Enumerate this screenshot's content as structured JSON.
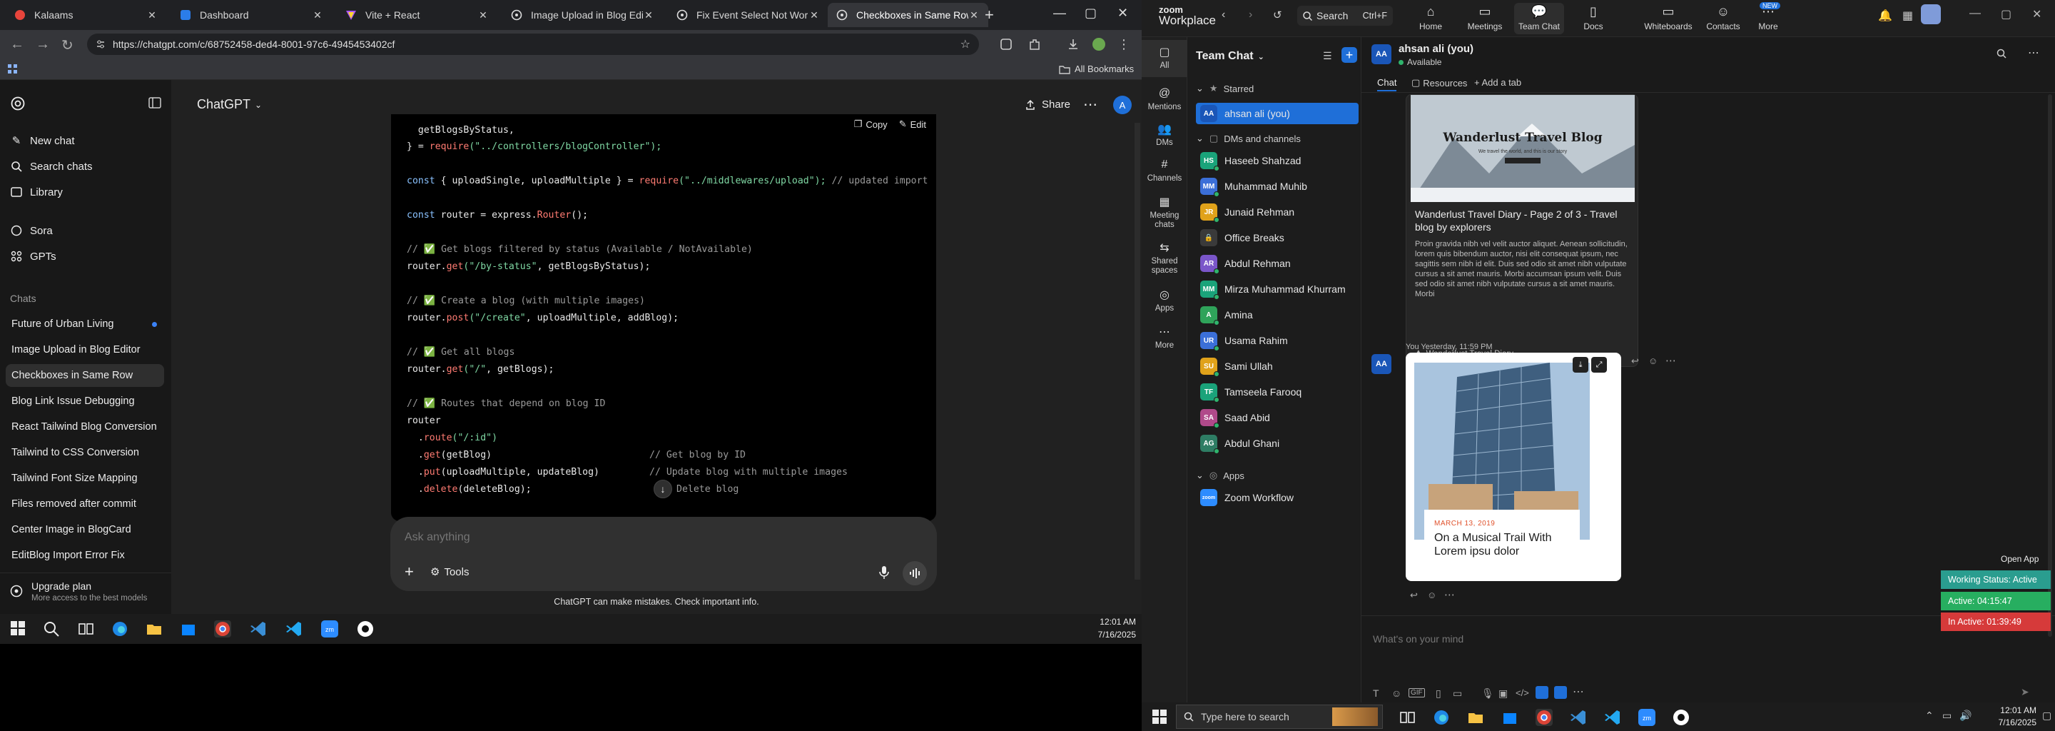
{
  "browser": {
    "tabs": [
      {
        "label": "Kalaams",
        "color": "#e8453c"
      },
      {
        "label": "Dashboard",
        "color": "#2b7de9"
      },
      {
        "label": "Vite + React",
        "color": "#a855f7"
      },
      {
        "label": "Image Upload in Blog Editor",
        "color": "#9aa0a6"
      },
      {
        "label": "Fix Event Select Not Working",
        "color": "#9aa0a6"
      },
      {
        "label": "Checkboxes in Same Row",
        "color": "#9aa0a6"
      }
    ],
    "url": "https://chatgpt.com/c/68752458-ded4-8001-97c6-4945453402cf",
    "all_bookmarks": "All Bookmarks"
  },
  "gpt": {
    "model": "ChatGPT",
    "share": "Share",
    "avatar": "A",
    "sidebar": {
      "new_chat": "New chat",
      "search": "Search chats",
      "library": "Library",
      "sora": "Sora",
      "gpts": "GPTs",
      "chats_heading": "Chats",
      "chats": [
        "Future of Urban Living",
        "Image Upload in Blog Editor",
        "Checkboxes in Same Row",
        "Blog Link Issue Debugging",
        "React Tailwind Blog Conversion",
        "Tailwind to CSS Conversion",
        "Tailwind Font Size Mapping",
        "Files removed after commit",
        "Center Image in BlogCard",
        "EditBlog Import Error Fix"
      ],
      "upgrade_title": "Upgrade plan",
      "upgrade_sub": "More access to the best models"
    },
    "code": {
      "copy": "Copy",
      "edit": "Edit",
      "l1": "  getBlogsByStatus,",
      "l2a": "} = ",
      "l2b": "require",
      "l2c": "(\"../controllers/blogController\");",
      "l3a": "const",
      "l3b": " { uploadSingle, uploadMultiple } = ",
      "l3c": "require",
      "l3d": "(\"../middlewares/upload\");",
      "l3e": " // updated import",
      "l4a": "const",
      "l4b": " router = express.",
      "l4c": "Router",
      "l4d": "();",
      "l5": "// ✅ Get blogs filtered by status (Available / NotAvailable)",
      "l6a": "router.",
      "l6b": "get",
      "l6c": "(\"/by-status\"",
      "l6d": ", getBlogsByStatus);",
      "l7": "// ✅ Create a blog (with multiple images)",
      "l8a": "router.",
      "l8b": "post",
      "l8c": "(\"/create\"",
      "l8d": ", uploadMultiple, addBlog);",
      "l9": "// ✅ Get all blogs",
      "l10a": "router.",
      "l10b": "get",
      "l10c": "(\"/\"",
      "l10d": ", getBlogs);",
      "l11": "// ✅ Routes that depend on blog ID",
      "l12": "router",
      "l13a": "  .",
      "l13b": "route",
      "l13c": "(\"/:id\")",
      "l14a": "  .",
      "l14b": "get",
      "l14c": "(getBlog)",
      "l14d": "// Get blog by ID",
      "l15a": "  .",
      "l15b": "put",
      "l15c": "(uploadMultiple, updateBlog)",
      "l15d": "// Update blog with multiple images",
      "l16a": "  .",
      "l16b": "delete",
      "l16c": "(deleteBlog);",
      "l16d": "Delete blog"
    },
    "composer_placeholder": "Ask anything",
    "tools": "Tools",
    "footer": "ChatGPT can make mistakes. Check important info."
  },
  "taskbar_left": {
    "time": "12:01 AM",
    "date": "7/16/2025"
  },
  "zoom": {
    "brand_top": "zoom",
    "brand_bottom": "Workplace",
    "search": "Search",
    "search_shortcut": "Ctrl+F",
    "top_tabs": [
      "Home",
      "Meetings",
      "Team Chat",
      "Docs",
      "Whiteboards",
      "Contacts",
      "More"
    ],
    "new_badge": "NEW",
    "rail": [
      "All",
      "Mentions",
      "DMs",
      "Channels",
      "Meeting chats",
      "Shared spaces",
      "Apps",
      "More"
    ],
    "list_title": "Team Chat",
    "starred": "Starred",
    "me": {
      "name": "ahsan ali (you)",
      "initials": "AA"
    },
    "dms_heading": "DMs and channels",
    "contacts": [
      {
        "name": "Haseeb Shahzad",
        "initials": "HS",
        "color": "#1aa37a"
      },
      {
        "name": "Muhammad Muhib",
        "initials": "MM",
        "color": "#3b6fd8"
      },
      {
        "name": "Junaid Rehman",
        "initials": "JR",
        "color": "#e0a21a"
      },
      {
        "name": "Office Breaks",
        "initials": "🔒",
        "color": "#3a3a3a"
      },
      {
        "name": "Abdul Rehman",
        "initials": "AR",
        "color": "#7a56c9"
      },
      {
        "name": "Mirza Muhammad Khurram",
        "initials": "MM",
        "color": "#1aa37a"
      },
      {
        "name": "Amina",
        "initials": "A",
        "color": "#2fa35a"
      },
      {
        "name": "Usama Rahim",
        "initials": "UR",
        "color": "#3b6fd8"
      },
      {
        "name": "Sami Ullah",
        "initials": "SU",
        "color": "#e0a21a"
      },
      {
        "name": "Tamseela Farooq",
        "initials": "TF",
        "color": "#1aa37a"
      },
      {
        "name": "Saad Abid",
        "initials": "SA",
        "color": "#b04a8a"
      },
      {
        "name": "Abdul Ghani",
        "initials": "AG",
        "color": "#2e7d64"
      }
    ],
    "apps_heading": "Apps",
    "app": {
      "name": "Zoom Workflow",
      "initials": "zoom"
    },
    "chat_head_name": "ahsan ali (you)",
    "chat_head_status": "Available",
    "chat_tabs": [
      "Chat",
      "Resources",
      "+ Add a tab"
    ],
    "link_card": {
      "hero_title": "Wanderlust Travel Blog",
      "hero_sub": "We travel the world, and this is our story",
      "title": "Wanderlust Travel Diary - Page 2 of 3 - Travel blog by explorers",
      "desc": "Proin gravida nibh vel velit auctor aliquet. Aenean sollicitudin, lorem quis bibendum auctor, nisi elit consequat ipsum, nec sagittis sem nibh id elit. Duis sed odio sit amet nibh vulputate cursus a sit amet mauris. Morbi accumsan ipsum velit. Duis sed odio sit amet nibh vulputate cursus a sit amet mauris. Morbi",
      "source": "Wanderlust Travel Diary"
    },
    "msg2_meta": "You Yesterday, 11:59 PM",
    "image_card": {
      "date": "MARCH 13, 2019",
      "title": "On a Musical Trail With Lorem ipsu dolor"
    },
    "composer_placeholder": "What's on your mind",
    "open_app": "Open App",
    "status": [
      {
        "label": "Working Status: Active",
        "color": "#2a9d8f"
      },
      {
        "label": "Active: 04:15:47",
        "color": "#27ae60"
      },
      {
        "label": "In Active: 01:39:49",
        "color": "#d63a3a"
      }
    ]
  },
  "taskbar_right": {
    "search_placeholder": "Type here to search",
    "time": "12:01 AM",
    "date": "7/16/2025"
  }
}
